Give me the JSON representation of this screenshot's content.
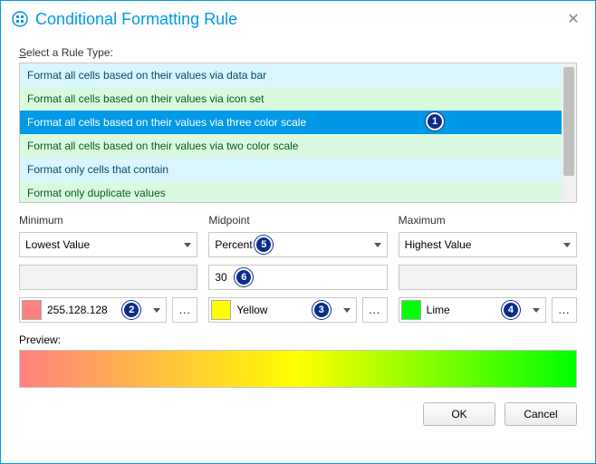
{
  "title": "Conditional Formatting Rule",
  "ruleTypeLabelPrefix": "S",
  "ruleTypeLabelRest": "elect a Rule Type:",
  "ruleTypes": [
    "Format all cells based on their values via data bar",
    "Format all cells based on their values via icon set",
    "Format all cells based on their values via three color scale",
    "Format all cells based on their values via two color scale",
    "Format only cells that contain",
    "Format only duplicate values"
  ],
  "selectedRuleIndex": 2,
  "columns": {
    "min": {
      "header": "Minimum",
      "type": "Lowest Value",
      "value": "",
      "colorName": "255.128.128",
      "colorHex": "#ff8080"
    },
    "mid": {
      "header": "Midpoint",
      "type": "Percent",
      "value": "30",
      "colorName": "Yellow",
      "colorHex": "#ffff00"
    },
    "max": {
      "header": "Maximum",
      "type": "Highest Value",
      "value": "",
      "colorName": "Lime",
      "colorHex": "#00ff00"
    }
  },
  "previewLabel": "Preview:",
  "buttons": {
    "ok": "OK",
    "cancel": "Cancel"
  },
  "moreGlyph": "...",
  "callouts": {
    "c1": "1",
    "c2": "2",
    "c3": "3",
    "c4": "4",
    "c5": "5",
    "c6": "6"
  }
}
